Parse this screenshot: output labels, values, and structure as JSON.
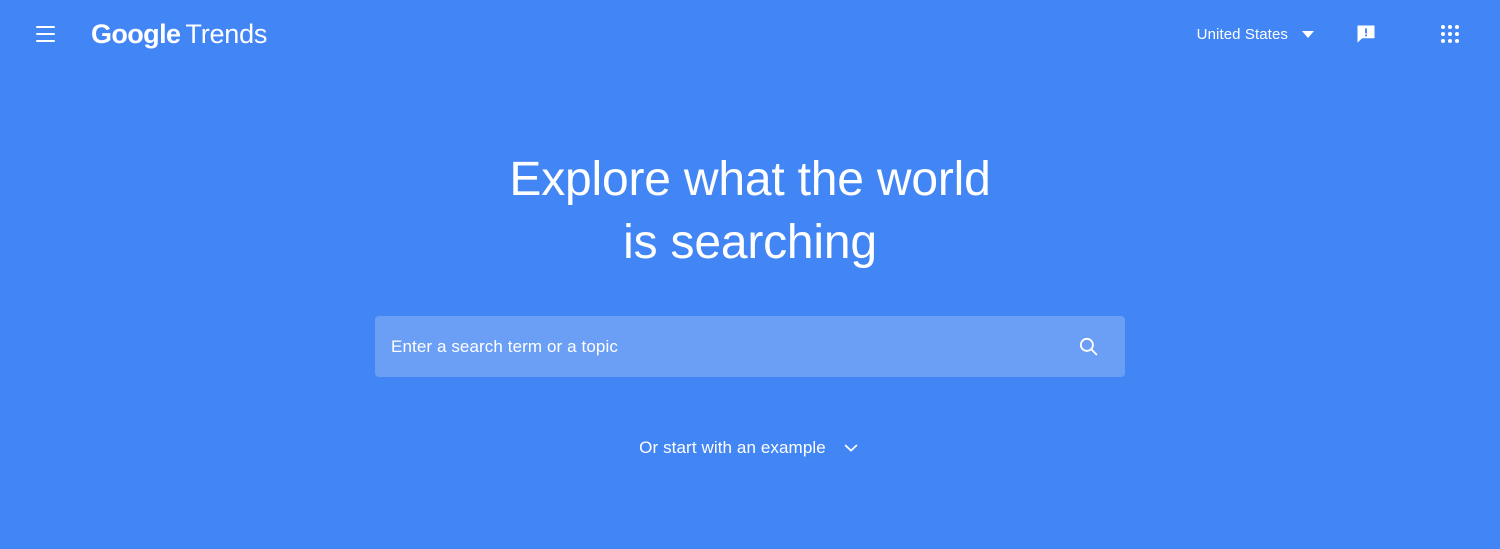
{
  "app": {
    "background_color": "#4285F4",
    "title": "Google Trends"
  },
  "header": {
    "menu_icon": "hamburger-menu-icon",
    "brand": {
      "primary": "Google",
      "secondary": "Trends"
    },
    "region": {
      "label": "United States",
      "caret_icon": "caret-down-icon"
    },
    "feedback": {
      "icon": "feedback-icon",
      "label": "Send feedback"
    },
    "apps": {
      "icon": "apps-grid-icon",
      "label": "Google apps"
    }
  },
  "hero": {
    "headline_line1": "Explore what the world",
    "headline_line2": "is searching"
  },
  "search": {
    "placeholder": "Enter a search term or a topic",
    "value": "",
    "submit_icon": "search-icon"
  },
  "example": {
    "label": "Or start with an example",
    "chevron_icon": "chevron-down-icon"
  }
}
